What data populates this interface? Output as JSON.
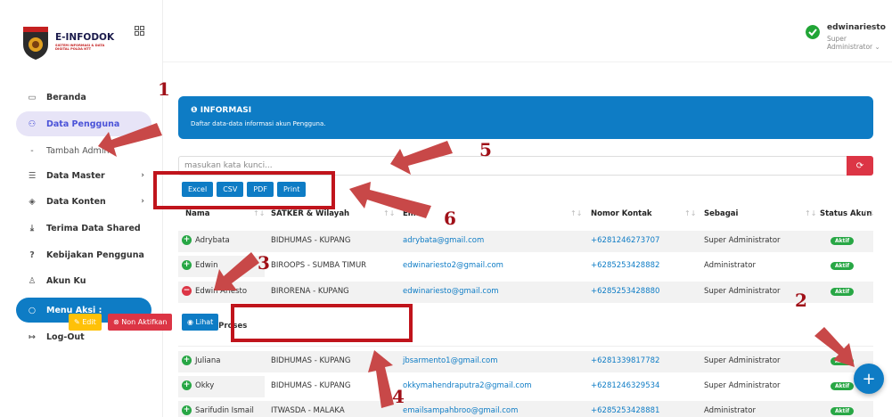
{
  "app": {
    "logo_title": "E-INFODOK",
    "logo_subtitle": "SISTEM INFORMASI & DATA DIGITAL POLDA NTT"
  },
  "user": {
    "name": "edwinariesto",
    "role": "Super Administrator ⌄"
  },
  "sidebar": {
    "items": [
      {
        "label": "Beranda",
        "icon": "home-icon"
      },
      {
        "label": "Data Pengguna",
        "icon": "users-icon"
      },
      {
        "label": "Tambah Admin",
        "icon": "dash"
      },
      {
        "label": "Data Master",
        "icon": "database-icon"
      },
      {
        "label": "Data Konten",
        "icon": "layers-icon"
      },
      {
        "label": "Terima Data Shared",
        "icon": "download-icon"
      },
      {
        "label": "Kebijakan Pengguna",
        "icon": "help-icon"
      },
      {
        "label": "Akun Ku",
        "icon": "user-icon"
      },
      {
        "label": "Menu Aksi :",
        "icon": "circle-icon"
      },
      {
        "label": "Log-Out",
        "icon": "logout-icon"
      }
    ]
  },
  "info": {
    "title": "❶ INFORMASI",
    "text": "Daftar data-data informasi akun Pengguna."
  },
  "search": {
    "placeholder": "masukan kata kunci..."
  },
  "export": {
    "excel": "Excel",
    "csv": "CSV",
    "pdf": "PDF",
    "print": "Print"
  },
  "table": {
    "headers": [
      "Nama",
      "SATKER & Wilayah",
      "Email",
      "Nomor Kontak",
      "Sebagai",
      "Status Akun"
    ],
    "rows": [
      {
        "name": "Adrybata",
        "satker": "BIDHUMAS - KUPANG",
        "email": "adrybata@gmail.com",
        "phone": "+6281246273707",
        "role": "Super Administrator",
        "status": "Aktif"
      },
      {
        "name": "Edwin",
        "satker": "BIROOPS - SUMBA TIMUR",
        "email": "edwinariesto2@gmail.com",
        "phone": "+6285253428882",
        "role": "Administrator",
        "status": "Aktif"
      },
      {
        "name": "Edwin Ariesto",
        "satker": "BIRORENA - KUPANG",
        "email": "edwinariesto@gmail.com",
        "phone": "+6285253428880",
        "role": "Super Administrator",
        "status": "Aktif"
      },
      {
        "name": "Juliana",
        "satker": "BIDHUMAS - KUPANG",
        "email": "jbsarmento1@gmail.com",
        "phone": "+6281339817782",
        "role": "Super Administrator",
        "status": "Aktif"
      },
      {
        "name": "Okky",
        "satker": "BIDHUMAS - KUPANG",
        "email": "okkymahendraputra2@gmail.com",
        "phone": "+6281246329534",
        "role": "Super Administrator",
        "status": "Aktif"
      },
      {
        "name": "Sarifudin Ismail",
        "satker": "ITWASDA - MALAKA",
        "email": "emailsampahbroo@gmail.com",
        "phone": "+6285253428881",
        "role": "Administrator",
        "status": "Aktif"
      }
    ],
    "proses_label": "Tombol Proses",
    "btn_edit": "✎ Edit",
    "btn_non": "⊗ Non Aktifkan",
    "btn_lihat": "◉ Lihat"
  },
  "annotations": [
    "1",
    "2",
    "3",
    "4",
    "5",
    "6"
  ],
  "colors": {
    "primary": "#0e7cc5",
    "danger": "#dc3545",
    "success": "#28a745",
    "warning": "#ffc107",
    "annotation": "#c0141c"
  }
}
